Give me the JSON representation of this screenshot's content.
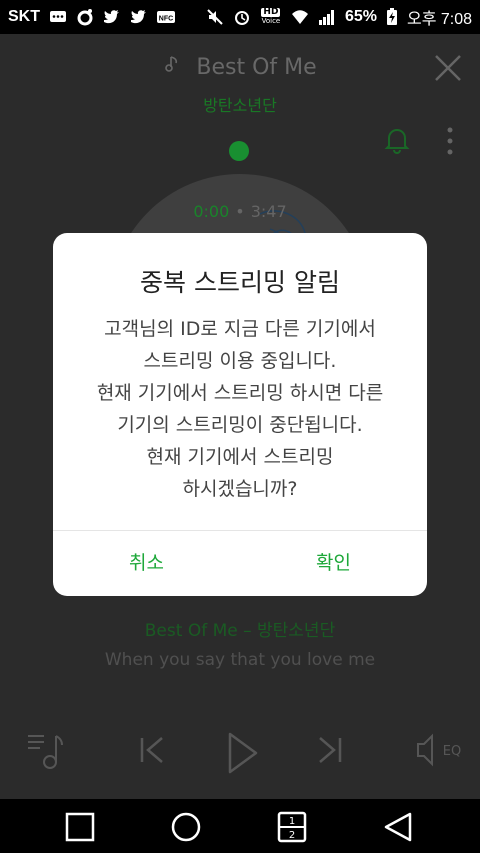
{
  "status_bar": {
    "carrier": "SKT",
    "battery": "65%",
    "time": "오후 7:08",
    "hd_label": "HD",
    "voice_label": "Voice",
    "nfc_label": "NFC"
  },
  "player": {
    "title": "Best Of Me",
    "artist": "방탄소년단",
    "current_time": "0:00",
    "separator": "•",
    "total_time": "3:47",
    "song_line": "Best Of Me – 방탄소년단",
    "lyric": "When you say that you love me",
    "eq_label": "EQ"
  },
  "dialog": {
    "title": "중복 스트리밍 알림",
    "body_lines": [
      "고객님의 ID로 지금 다른 기기에서",
      "스트리밍 이용 중입니다.",
      "현재 기기에서 스트리밍 하시면 다른",
      "기기의 스트리밍이 중단됩니다.",
      "현재 기기에서 스트리밍",
      "하시겠습니까?"
    ],
    "cancel_label": "취소",
    "ok_label": "확인"
  },
  "nav_bar": {
    "dual_window_top": "1",
    "dual_window_bottom": "2"
  },
  "colors": {
    "accent_green": "#1ea83a",
    "dark_green": "#1f6b2a"
  }
}
